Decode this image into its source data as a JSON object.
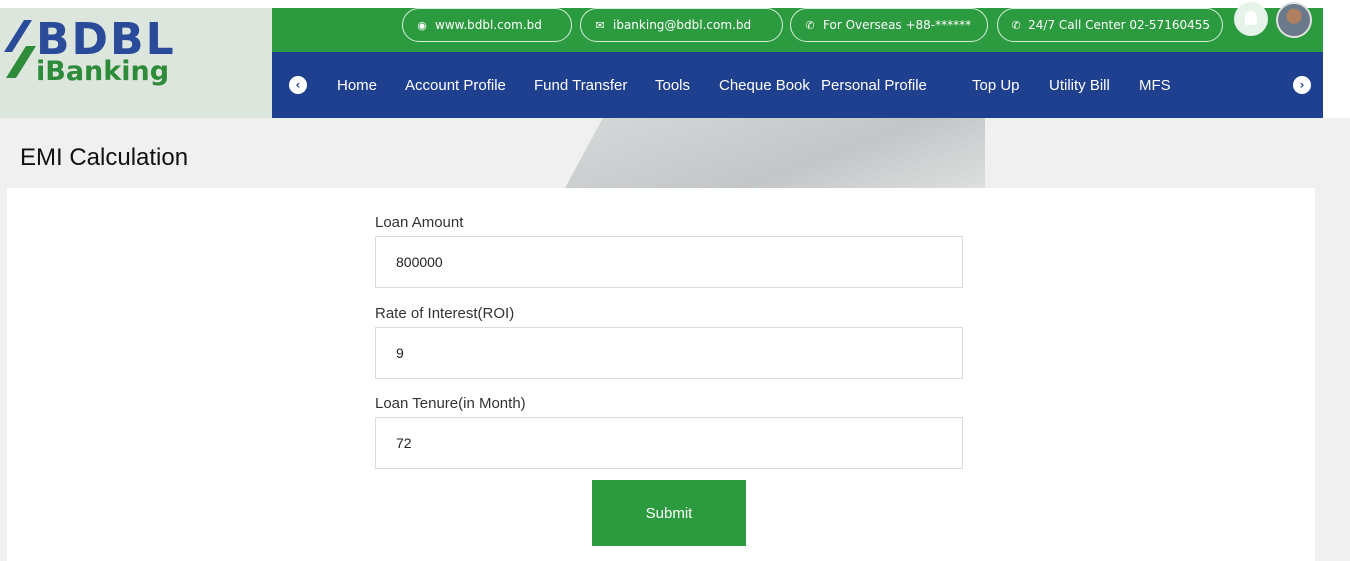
{
  "brand": {
    "name": "BDBL",
    "product": "iBanking",
    "primary_color": "#1f3f8f",
    "accent_color": "#2c9a3e"
  },
  "topbar": {
    "website": {
      "icon": "globe-icon",
      "text": "www.bdbl.com.bd"
    },
    "email": {
      "icon": "envelope-icon",
      "text": "ibanking@bdbl.com.bd"
    },
    "overseas": {
      "icon": "phone-icon",
      "text": "For Overseas +88-******"
    },
    "call_center": {
      "icon": "phone-icon",
      "text": "24/7 Call Center 02-57160455"
    }
  },
  "nav": {
    "items": [
      {
        "label": "Home"
      },
      {
        "label": "Account Profile"
      },
      {
        "label": "Fund Transfer"
      },
      {
        "label": "Tools"
      },
      {
        "label": "Cheque Book"
      },
      {
        "label": "Personal Profile"
      },
      {
        "label": "Top Up"
      },
      {
        "label": "Utility Bill"
      },
      {
        "label": "MFS"
      }
    ]
  },
  "page": {
    "title": "EMI Calculation"
  },
  "form": {
    "loan_amount": {
      "label": "Loan Amount",
      "value": "800000"
    },
    "rate_of_interest": {
      "label": "Rate of Interest(ROI)",
      "value": "9"
    },
    "loan_tenure": {
      "label": "Loan Tenure(in Month)",
      "value": "72"
    },
    "submit_label": "Submit"
  }
}
